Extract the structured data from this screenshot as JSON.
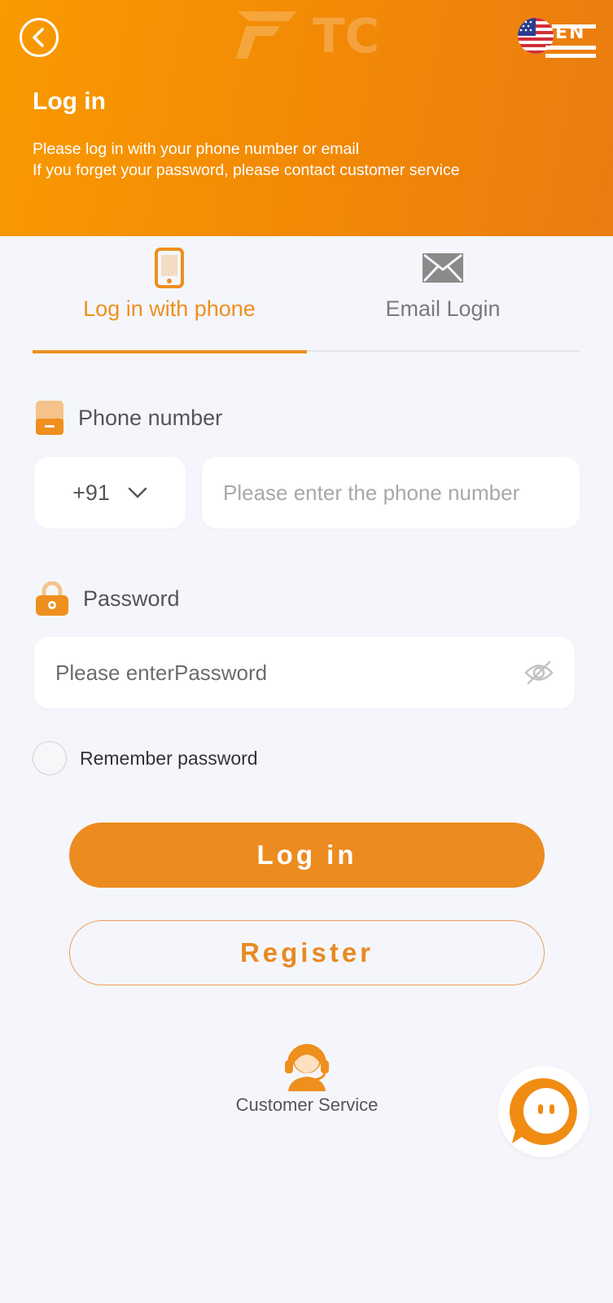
{
  "header": {
    "logo_text": "TC",
    "language": "EN",
    "title": "Log in",
    "subtitle_line1": "Please log in with your phone number or email",
    "subtitle_line2": "If you forget your password, please contact customer service"
  },
  "tabs": [
    {
      "label": "Log in with phone",
      "icon": "phone-icon",
      "active": true
    },
    {
      "label": "Email Login",
      "icon": "mail-icon",
      "active": false
    }
  ],
  "phone": {
    "label": "Phone number",
    "country_code": "+91",
    "placeholder": "Please enter the phone number"
  },
  "password": {
    "label": "Password",
    "placeholder": "Please enterPassword"
  },
  "remember": {
    "label": "Remember password",
    "checked": false
  },
  "buttons": {
    "login": "Log in",
    "register": "Register"
  },
  "customer_service": {
    "label": "Customer Service"
  },
  "colors": {
    "accent": "#ee8f1e",
    "header_start": "#f99a00",
    "header_end": "#ea7c10",
    "background": "#f5f6fb"
  }
}
